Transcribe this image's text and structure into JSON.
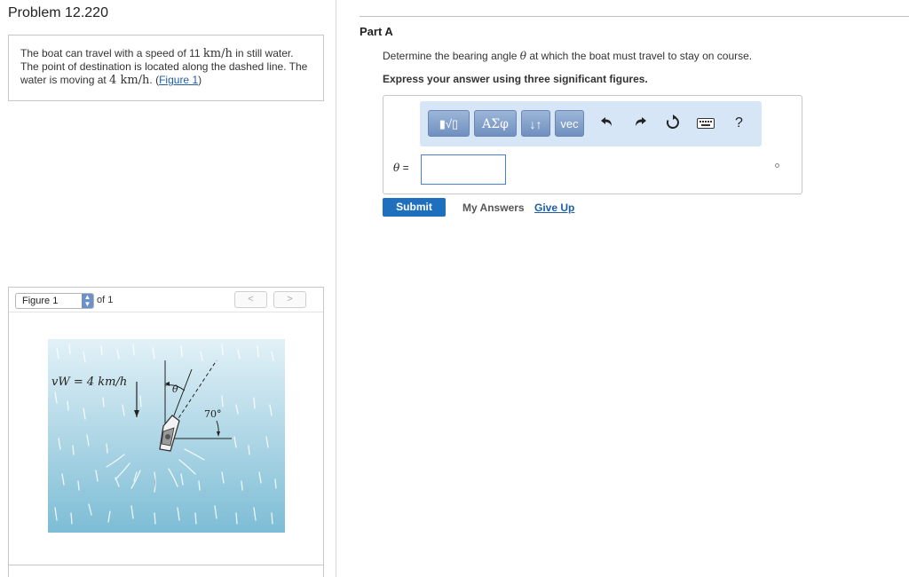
{
  "problem": {
    "title": "Problem 12.220",
    "text_1": "The boat can travel with a speed of 11 ",
    "speed_math": "km/h",
    "text_2": " in still water. The point of destination is located along the dashed line. The water is moving at ",
    "water_math": "4 km/h",
    "text_3": ". (",
    "figure_link": "Figure 1",
    "text_4": ")"
  },
  "figure": {
    "select_label": "Figure 1",
    "of_label": "of 1",
    "prev_label": "<",
    "next_label": ">",
    "vw_label": "vW = 4 km/h",
    "theta_label": "θ",
    "angle_label": "70°",
    "colors": {
      "water_top": "#dfeff6",
      "water_bottom": "#7fbfd6"
    }
  },
  "part": {
    "title": "Part A",
    "question_1": "Determine the bearing angle ",
    "question_symbol": "θ",
    "question_2": " at which the boat must travel to stay on course.",
    "instructions": "Express your answer using three significant figures."
  },
  "toolbar": {
    "templates_icon": "templates-icon",
    "templates_label": "▮√▯",
    "greek_label": "ΑΣφ",
    "arrows_label": "↓↑",
    "vec_label": "vec",
    "undo_icon": "undo-icon",
    "redo_icon": "redo-icon",
    "reset_icon": "reset-icon",
    "keyboard_icon": "keyboard-icon",
    "help_label": "?"
  },
  "answer": {
    "symbol": "θ",
    "equals": " =",
    "value": ""
  },
  "actions": {
    "submit_label": "Submit",
    "my_answers_label": "My Answers",
    "give_up_label": "Give Up"
  }
}
